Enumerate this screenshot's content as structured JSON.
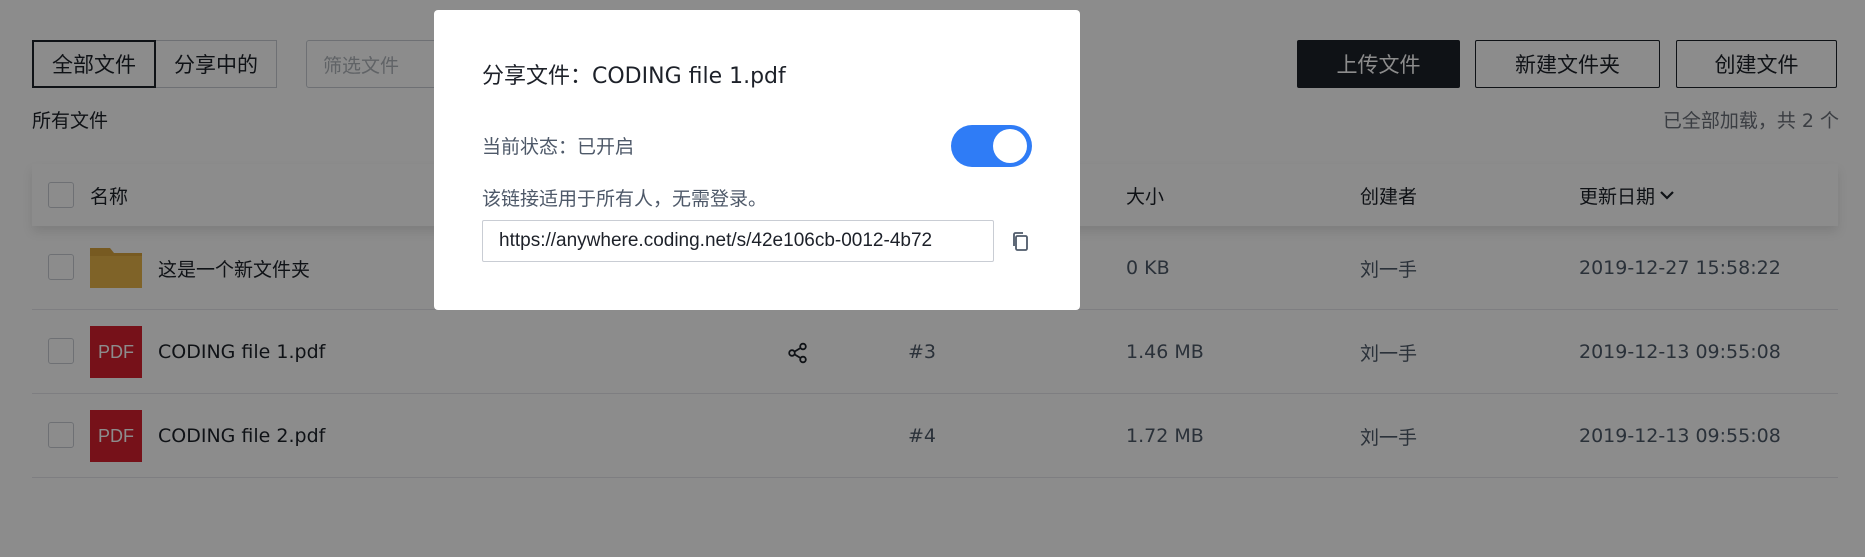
{
  "toolbar": {
    "tab_all": "全部文件",
    "tab_sharing": "分享中的",
    "filter_placeholder": "筛选文件",
    "upload": "上传文件",
    "new_folder": "新建文件夹",
    "create_file": "创建文件"
  },
  "subheader": {
    "all_files": "所有文件",
    "loaded_status": "已全部加载，共 2 个"
  },
  "table": {
    "headers": {
      "name": "名称",
      "size": "大小",
      "creator": "创建者",
      "updated": "更新日期"
    },
    "rows": [
      {
        "name": "这是一个新文件夹",
        "type": "folder",
        "id": "",
        "size": "0 KB",
        "creator": "刘一手",
        "date": "2019-12-27 15:58:22"
      },
      {
        "name": "CODING file 1.pdf",
        "type": "pdf",
        "id": "#3",
        "size": "1.46 MB",
        "creator": "刘一手",
        "date": "2019-12-13 09:55:08",
        "shared": true
      },
      {
        "name": "CODING file 2.pdf",
        "type": "pdf",
        "id": "#4",
        "size": "1.72 MB",
        "creator": "刘一手",
        "date": "2019-12-13 09:55:08"
      }
    ],
    "pdf_label": "PDF"
  },
  "modal": {
    "title": "分享文件：CODING file 1.pdf",
    "status": "当前状态：已开启",
    "toggle_on": true,
    "hint": "该链接适用于所有人，无需登录。",
    "link": "https://anywhere.coding.net/s/42e106cb-0012-4b72"
  },
  "colors": {
    "primary_dark": "#1d2129",
    "toggle_blue": "#2f7cf6",
    "pdf_red": "#d71f2e",
    "folder_yellow": "#e8b54a"
  }
}
